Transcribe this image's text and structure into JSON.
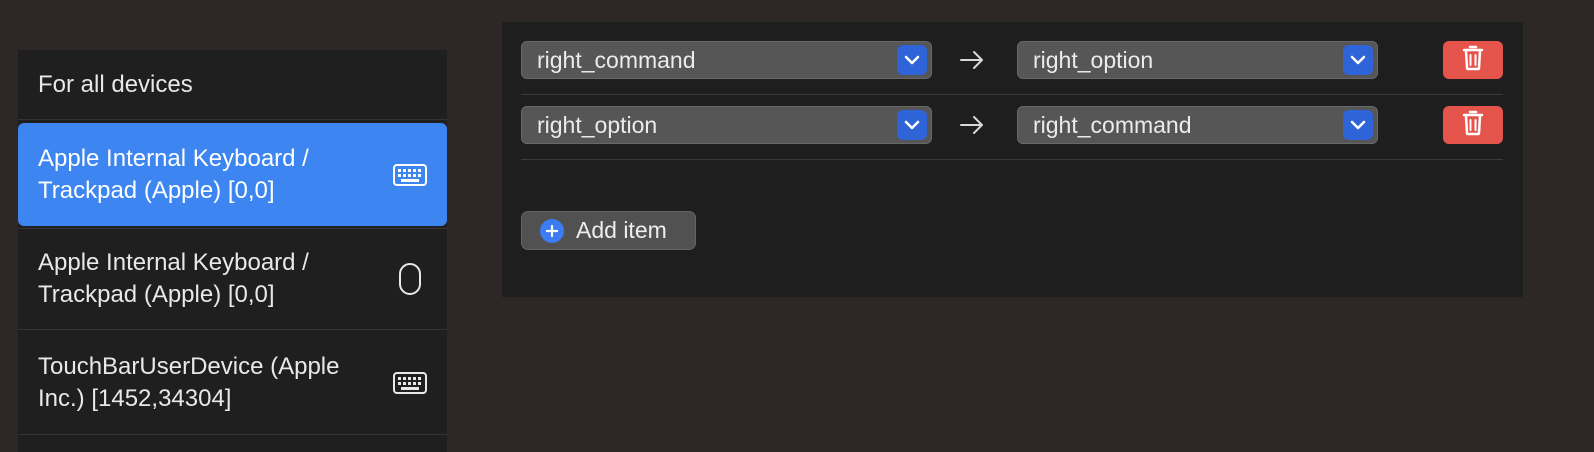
{
  "sidebar": {
    "items": [
      {
        "label": "For all devices",
        "icon": "",
        "selected": false
      },
      {
        "label": "Apple Internal Keyboard / Trackpad (Apple) [0,0]",
        "icon": "keyboard-icon",
        "selected": true
      },
      {
        "label": "Apple Internal Keyboard / Trackpad (Apple) [0,0]",
        "icon": "mouse-icon",
        "selected": false
      },
      {
        "label": "TouchBarUserDevice (Apple Inc.) [1452,34304]",
        "icon": "keyboard-icon",
        "selected": false
      }
    ]
  },
  "mappings": [
    {
      "from": "right_command",
      "to": "right_option"
    },
    {
      "from": "right_option",
      "to": "right_command"
    }
  ],
  "add_item_label": "Add item",
  "colors": {
    "background": "#2d2726",
    "sidebar": "#1f1f1f",
    "selected": "#3d85f1",
    "panel": "#1e1e1e",
    "select_chevron": "#2f63d8",
    "delete": "#e5544a",
    "add_plus": "#3b7cf0"
  }
}
